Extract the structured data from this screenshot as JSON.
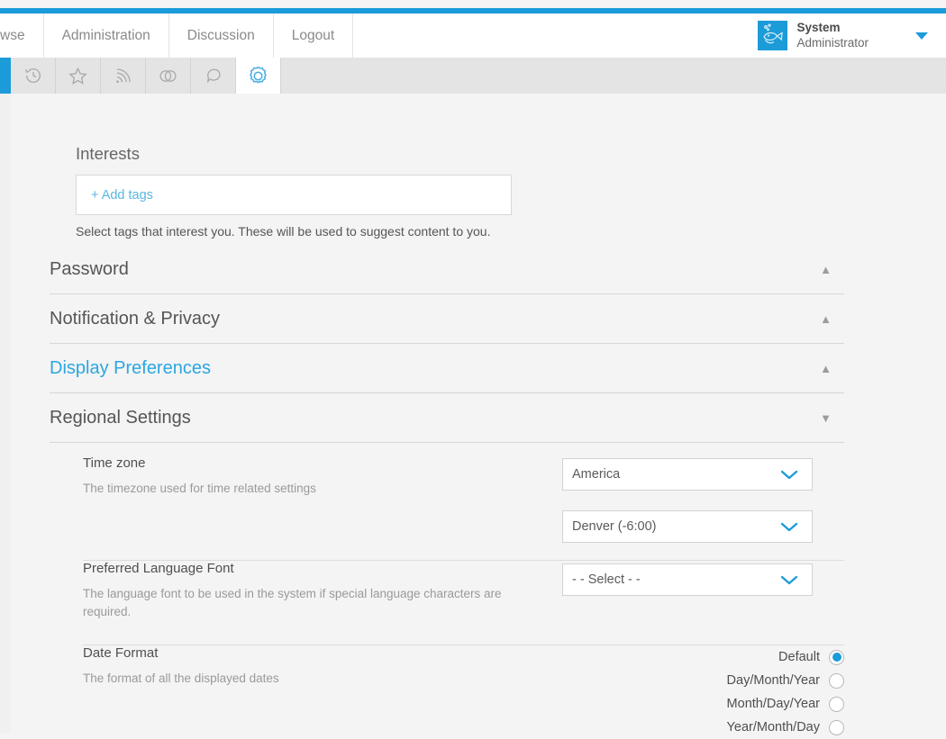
{
  "theme": {
    "accent": "#1b9bd8",
    "link": "#5ab6e0",
    "page_bg": "#f4f4f4",
    "text": "#4f4f4f",
    "muted": "#9a9a9a"
  },
  "navbar": {
    "items": [
      {
        "label": "wse",
        "name": "nav-item-browse"
      },
      {
        "label": "Administration",
        "name": "nav-item-administration"
      },
      {
        "label": "Discussion",
        "name": "nav-item-discussion"
      },
      {
        "label": "Logout",
        "name": "nav-item-logout"
      }
    ],
    "user": {
      "first_line": "System",
      "second_line": "Administrator",
      "avatar_icon": "fish-avatar-icon",
      "caret_icon": "caret-down-icon"
    }
  },
  "toolbar": {
    "buttons": [
      {
        "name": "history-icon",
        "label": "history",
        "active": false
      },
      {
        "name": "star-icon",
        "label": "favorites",
        "active": false
      },
      {
        "name": "rss-icon",
        "label": "feed",
        "active": false
      },
      {
        "name": "venn-icon",
        "label": "connections",
        "active": false
      },
      {
        "name": "speech-bubble-icon",
        "label": "discussion",
        "active": false
      },
      {
        "name": "gear-icon",
        "label": "settings",
        "active": true
      }
    ]
  },
  "interests": {
    "label": "Interests",
    "add_tags_label": "+ Add tags",
    "help_text": "Select tags that interest you. These will be used to suggest content to you."
  },
  "sections": [
    {
      "title": "Password",
      "caret": "▲",
      "highlight": false,
      "name": "section-password"
    },
    {
      "title": "Notification & Privacy",
      "caret": "▲",
      "highlight": false,
      "name": "section-notification-privacy"
    },
    {
      "title": "Display Preferences",
      "caret": "▲",
      "highlight": true,
      "name": "section-display-preferences"
    },
    {
      "title": "Regional Settings",
      "caret": "▼",
      "highlight": false,
      "name": "section-regional-settings"
    }
  ],
  "regional": {
    "timezone": {
      "label": "Time zone",
      "description": "The timezone used for time related settings",
      "region_value": "America",
      "city_value": "Denver (-6:00)"
    },
    "language_font": {
      "label": "Preferred Language Font",
      "description": "The language font to be used in the system if special language characters are required.",
      "value": "- - Select - -"
    },
    "date_format": {
      "label": "Date Format",
      "description": "The format of all the displayed dates",
      "options": [
        {
          "label": "Default",
          "selected": true
        },
        {
          "label": "Day/Month/Year",
          "selected": false
        },
        {
          "label": "Month/Day/Year",
          "selected": false
        },
        {
          "label": "Year/Month/Day",
          "selected": false
        }
      ]
    }
  }
}
